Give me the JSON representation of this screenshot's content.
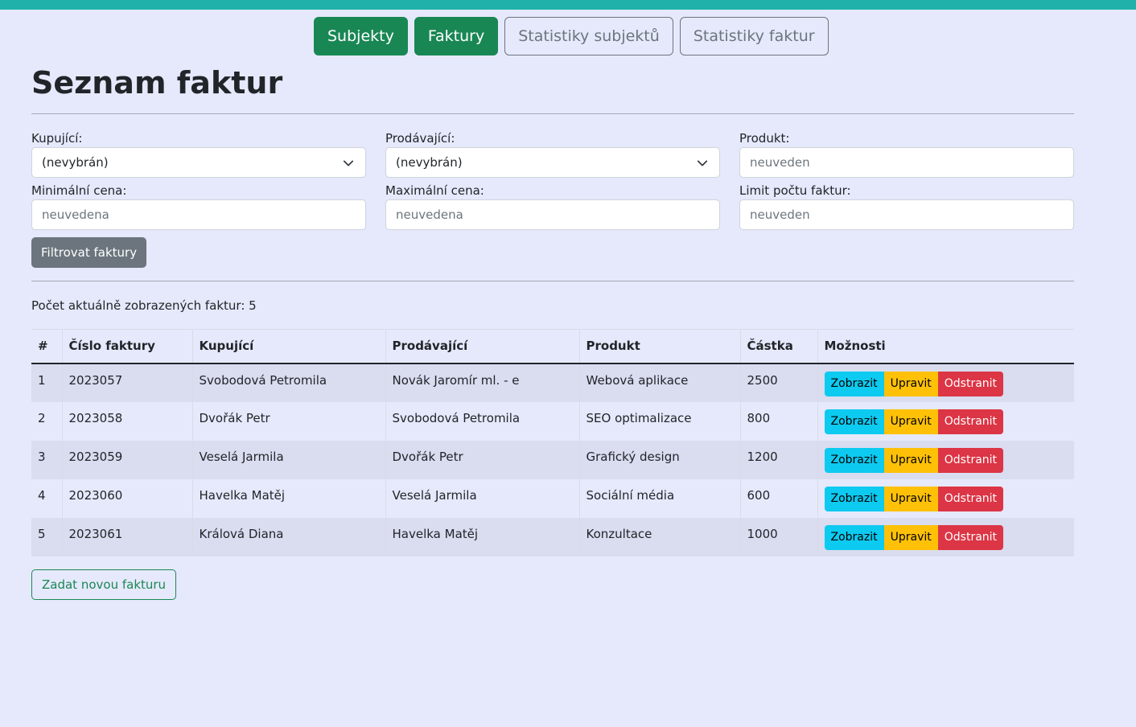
{
  "nav": [
    {
      "label": "Subjekty",
      "active": true
    },
    {
      "label": "Faktury",
      "active": true
    },
    {
      "label": "Statistiky subjektů",
      "active": false
    },
    {
      "label": "Statistiky faktur",
      "active": false
    }
  ],
  "page_title": "Seznam faktur",
  "filters": {
    "buyer": {
      "label": "Kupující:",
      "value": "(nevybrán)"
    },
    "seller": {
      "label": "Prodávající:",
      "value": "(nevybrán)"
    },
    "product": {
      "label": "Produkt:",
      "placeholder": "neuveden"
    },
    "min_price": {
      "label": "Minimální cena:",
      "placeholder": "neuvedena"
    },
    "max_price": {
      "label": "Maximální cena:",
      "placeholder": "neuvedena"
    },
    "limit": {
      "label": "Limit počtu faktur:",
      "placeholder": "neuveden"
    },
    "submit_label": "Filtrovat faktury"
  },
  "count_text": "Počet aktuálně zobrazených faktur: 5",
  "table": {
    "headers": [
      "#",
      "Číslo faktury",
      "Kupující",
      "Prodávající",
      "Produkt",
      "Částka",
      "Možnosti"
    ],
    "rows": [
      [
        "1",
        "2023057",
        "Svobodová Petromila",
        "Novák Jaromír ml. - e",
        "Webová aplikace",
        "2500"
      ],
      [
        "2",
        "2023058",
        "Dvořák Petr",
        "Svobodová Petromila",
        "SEO optimalizace",
        "800"
      ],
      [
        "3",
        "2023059",
        "Veselá Jarmila",
        "Dvořák Petr",
        "Grafický design",
        "1200"
      ],
      [
        "4",
        "2023060",
        "Havelka Matěj",
        "Veselá Jarmila",
        "Sociální média",
        "600"
      ],
      [
        "5",
        "2023061",
        "Králová Diana",
        "Havelka Matěj",
        "Konzultace",
        "1000"
      ]
    ],
    "actions": {
      "view": "Zobrazit",
      "edit": "Upravit",
      "delete": "Odstranit"
    }
  },
  "new_invoice_label": "Zadat novou fakturu",
  "colors": {
    "accent_bar": "#20b2aa",
    "primary_green": "#198754",
    "info": "#0dcaf0",
    "warning": "#ffc107",
    "danger": "#dc3545",
    "background": "#e6e9fb"
  },
  "icons": {
    "select_chevron": "chevron-down-icon"
  }
}
